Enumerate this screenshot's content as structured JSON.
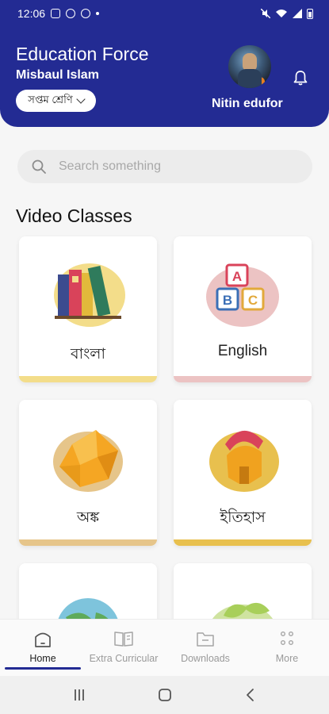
{
  "status_bar": {
    "time": "12:06"
  },
  "header": {
    "app_title": "Education Force",
    "user_name": "Misbaul Islam",
    "class_select": "সপ্তম শ্রেণি",
    "profile_name": "Nitin edufor"
  },
  "search": {
    "placeholder": "Search something"
  },
  "section_title": "Video Classes",
  "subjects": [
    {
      "label": "বাংলা",
      "icon": "books-icon",
      "accent": "#f3dd8a"
    },
    {
      "label": "English",
      "icon": "abc-blocks-icon",
      "accent": "#ecc3c3"
    },
    {
      "label": "অঙ্ক",
      "icon": "cube-icon",
      "accent": "#e6c58a"
    },
    {
      "label": "ইতিহাস",
      "icon": "helmet-icon",
      "accent": "#e8c04e"
    }
  ],
  "nav": [
    {
      "label": "Home",
      "icon": "home-icon"
    },
    {
      "label": "Extra Curricular",
      "icon": "book-open-icon"
    },
    {
      "label": "Downloads",
      "icon": "folder-icon"
    },
    {
      "label": "More",
      "icon": "grid-dots-icon"
    }
  ],
  "colors": {
    "header": "#232b93",
    "accent": "#232b93"
  }
}
